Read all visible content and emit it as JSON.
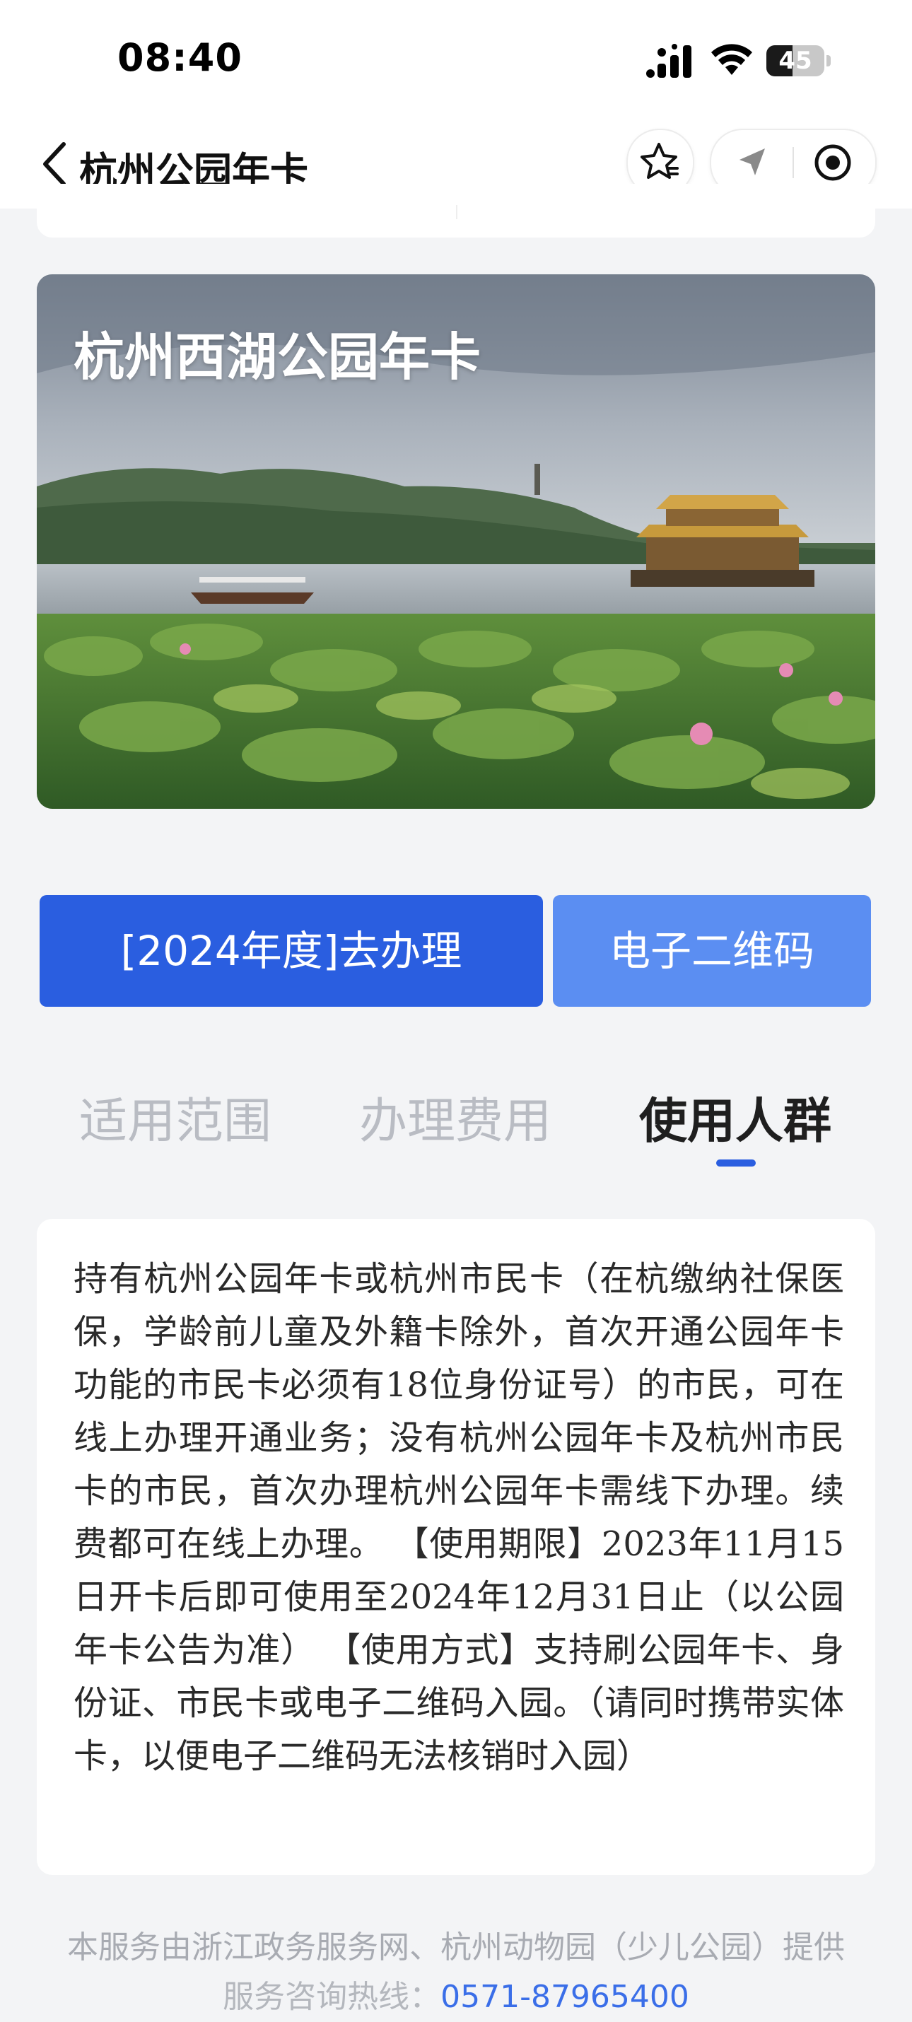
{
  "status_bar": {
    "time": "08:40",
    "battery_level": "45",
    "battery_fraction": 0.45,
    "icons": [
      "cellular-signal-icon",
      "wifi-icon",
      "battery-icon"
    ]
  },
  "nav": {
    "title": "杭州公园年卡",
    "icons": [
      "back-chevron-icon",
      "star-icon",
      "location-arrow-icon",
      "record-circle-icon"
    ]
  },
  "banner": {
    "title": "杭州西湖公园年卡"
  },
  "actions": {
    "apply_label": "[2024年度]去办理",
    "qrcode_label": "电子二维码"
  },
  "tabs": [
    {
      "label": "适用范围",
      "active": false
    },
    {
      "label": "办理费用",
      "active": false
    },
    {
      "label": "使用人群",
      "active": true
    }
  ],
  "content": {
    "text": "持有杭州公园年卡或杭州市民卡（在杭缴纳社保医保，学龄前儿童及外籍卡除外，首次开通公园年卡功能的市民卡必须有18位身份证号）的市民，可在线上办理开通业务；没有杭州公园年卡及杭州市民卡的市民，首次办理杭州公园年卡需线下办理。续费都可在线上办理。 【使用期限】2023年11月15日开卡后即可使用至2024年12月31日止（以公园年卡公告为准） 【使用方式】支持刷公园年卡、身份证、市民卡或电子二维码入园。（请同时携带实体卡，以便电子二维码无法核销时入园）"
  },
  "footer": {
    "provider_text": "本服务由浙江政务服务网、杭州动物园（少儿公园）提供",
    "hotline_label": "服务咨询热线：",
    "hotline_number": "0571-87965400"
  },
  "colors": {
    "primary": "#2a5ee0",
    "primary_light": "#5b8ef2",
    "background": "#f3f4f6"
  }
}
